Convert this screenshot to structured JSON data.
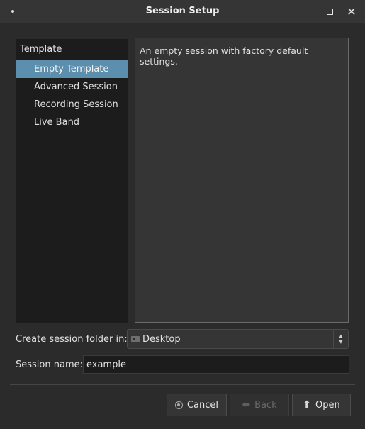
{
  "window": {
    "title": "Session Setup",
    "maximize_icon": "maximize-icon",
    "close_glyph": "✕"
  },
  "templates": {
    "header": "Template",
    "items": [
      {
        "label": "Empty Template",
        "selected": true
      },
      {
        "label": "Advanced Session",
        "selected": false
      },
      {
        "label": "Recording Session",
        "selected": false
      },
      {
        "label": "Live Band",
        "selected": false
      }
    ],
    "description": "An empty session with factory default settings."
  },
  "folder": {
    "label": "Create session folder in:",
    "value": "Desktop"
  },
  "session_name": {
    "label": "Session name:",
    "value": "example"
  },
  "buttons": {
    "cancel": "Cancel",
    "back": "Back",
    "open": "Open"
  },
  "colors": {
    "selection": "#5c8fae",
    "background": "#2b2b2b",
    "list_background": "#1c1c1c"
  }
}
